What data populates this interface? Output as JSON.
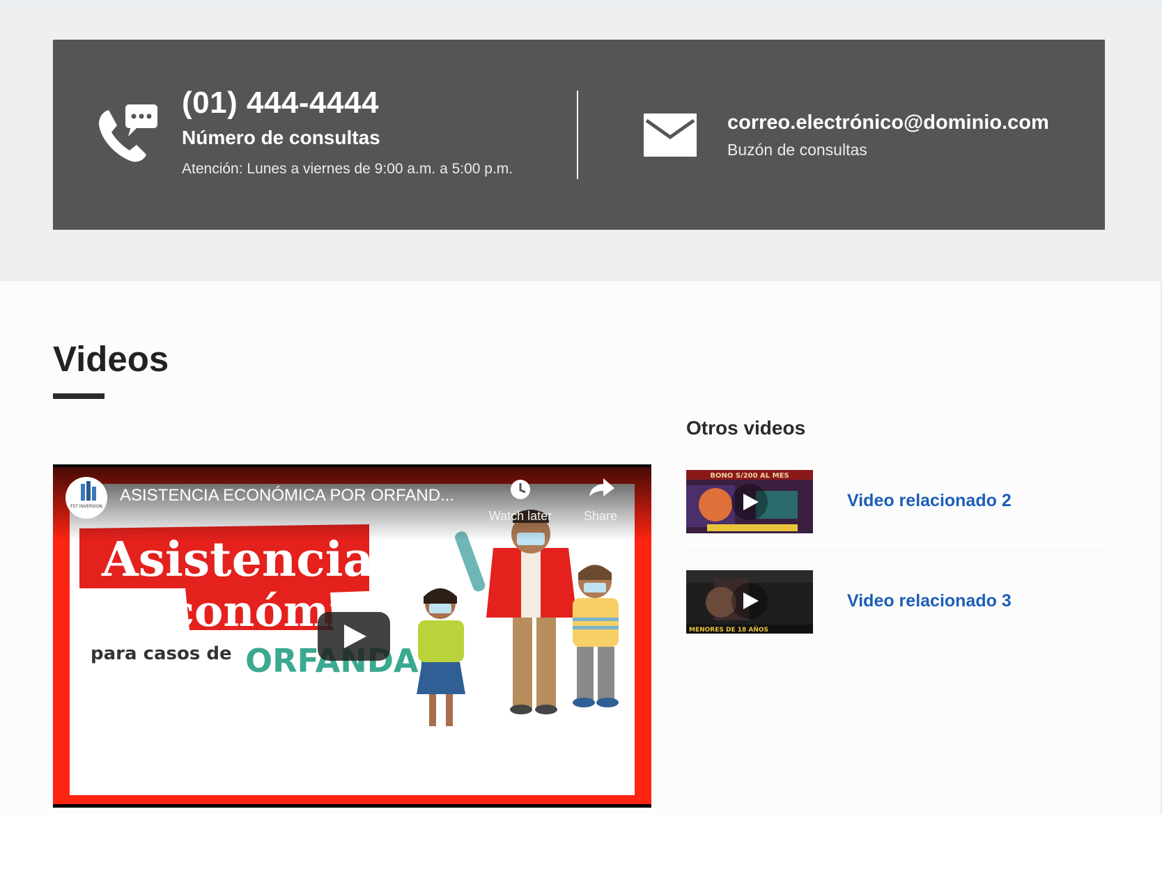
{
  "contact": {
    "phone_number": "(01) 444-4444",
    "phone_label": "Número de consultas",
    "phone_hours": "Atención: Lunes a viernes de 9:00 a.m. a 5:00 p.m.",
    "email": "correo.electrónico@dominio.com",
    "email_label": "Buzón de consultas"
  },
  "videos": {
    "title": "Videos",
    "main_video": {
      "title": "ASISTENCIA ECONÓMICA POR ORFAND...",
      "watch_later": "Watch later",
      "share": "Share",
      "thumb_line1": "Asistencia",
      "thumb_line2": "Económica",
      "thumb_line3": "para casos de",
      "thumb_line4": "ORFANDAD",
      "channel_text": "FST INVERSION"
    },
    "other_title": "Otros videos",
    "related": [
      {
        "label": "Video relacionado 2",
        "thumb_text": "BONO S/200 AL MES"
      },
      {
        "label": "Video relacionado 3",
        "thumb_text": "MENORES DE 18 AÑOS"
      }
    ]
  },
  "colors": {
    "contact_bg": "#555555",
    "accent_link": "#1d5eb8",
    "video_red": "#e4211d",
    "orfandad_teal": "#3aa98f"
  }
}
